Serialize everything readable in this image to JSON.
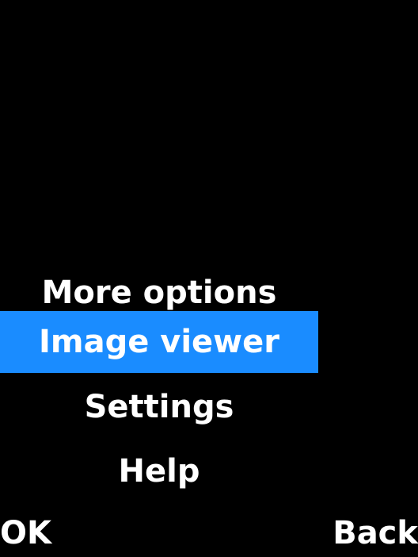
{
  "menu": {
    "items": [
      {
        "label": "More options",
        "selected": false
      },
      {
        "label": "Image viewer",
        "selected": true
      },
      {
        "label": "Settings",
        "selected": false
      },
      {
        "label": "Help",
        "selected": false
      }
    ]
  },
  "softkeys": {
    "left": "OK",
    "right": "Back"
  },
  "colors": {
    "background": "#000000",
    "highlight": "#1a8cff",
    "text": "#ffffff"
  }
}
